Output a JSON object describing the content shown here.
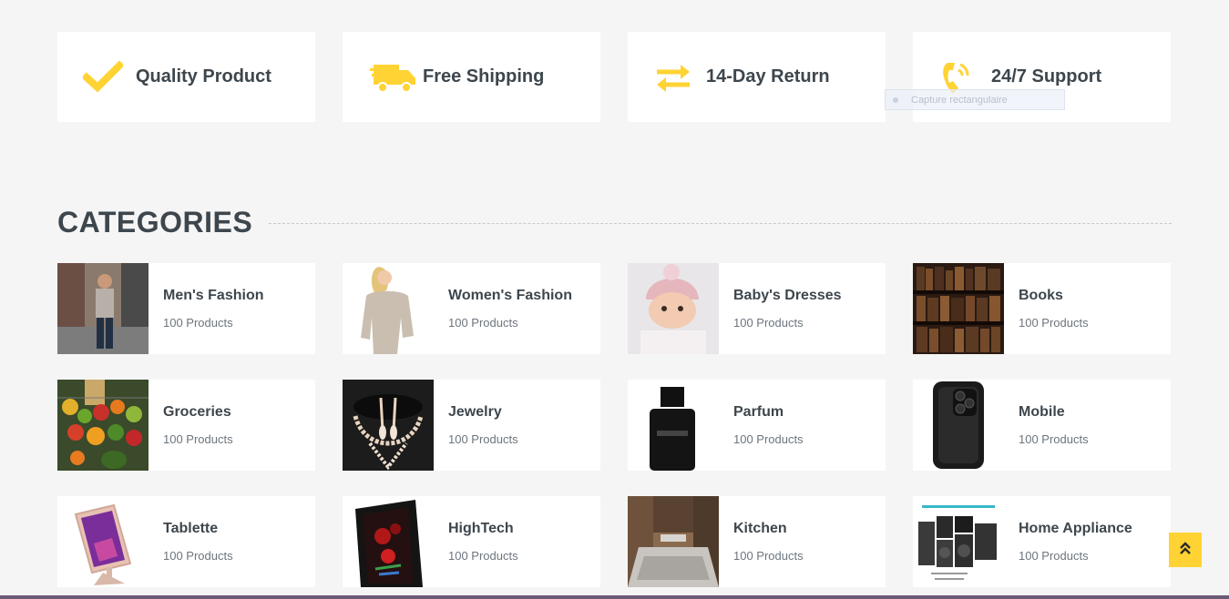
{
  "features": [
    {
      "icon": "check-icon",
      "label": "Quality Product"
    },
    {
      "icon": "truck-icon",
      "label": "Free Shipping"
    },
    {
      "icon": "exchange-icon",
      "label": "14-Day Return"
    },
    {
      "icon": "phone-icon",
      "label": "24/7 Support"
    }
  ],
  "capture_tooltip": "Capture rectangulaire",
  "categories_section": {
    "title": "CATEGORIES",
    "items": [
      {
        "name": "Men's Fashion",
        "count": "100 Products"
      },
      {
        "name": "Women's Fashion",
        "count": "100 Products"
      },
      {
        "name": "Baby's Dresses",
        "count": "100 Products"
      },
      {
        "name": "Books",
        "count": "100 Products"
      },
      {
        "name": "Groceries",
        "count": "100 Products"
      },
      {
        "name": "Jewelry",
        "count": "100 Products"
      },
      {
        "name": "Parfum",
        "count": "100 Products"
      },
      {
        "name": "Mobile",
        "count": "100 Products"
      },
      {
        "name": "Tablette",
        "count": "100 Products"
      },
      {
        "name": "HighTech",
        "count": "100 Products"
      },
      {
        "name": "Kitchen",
        "count": "100 Products"
      },
      {
        "name": "Home Appliance",
        "count": "100 Products"
      }
    ]
  },
  "colors": {
    "accent": "#FFD333",
    "text": "#3D464D",
    "muted": "#6C757D",
    "background": "#F5F5F5"
  },
  "back_to_top_icon": "double-chevron-up-icon"
}
